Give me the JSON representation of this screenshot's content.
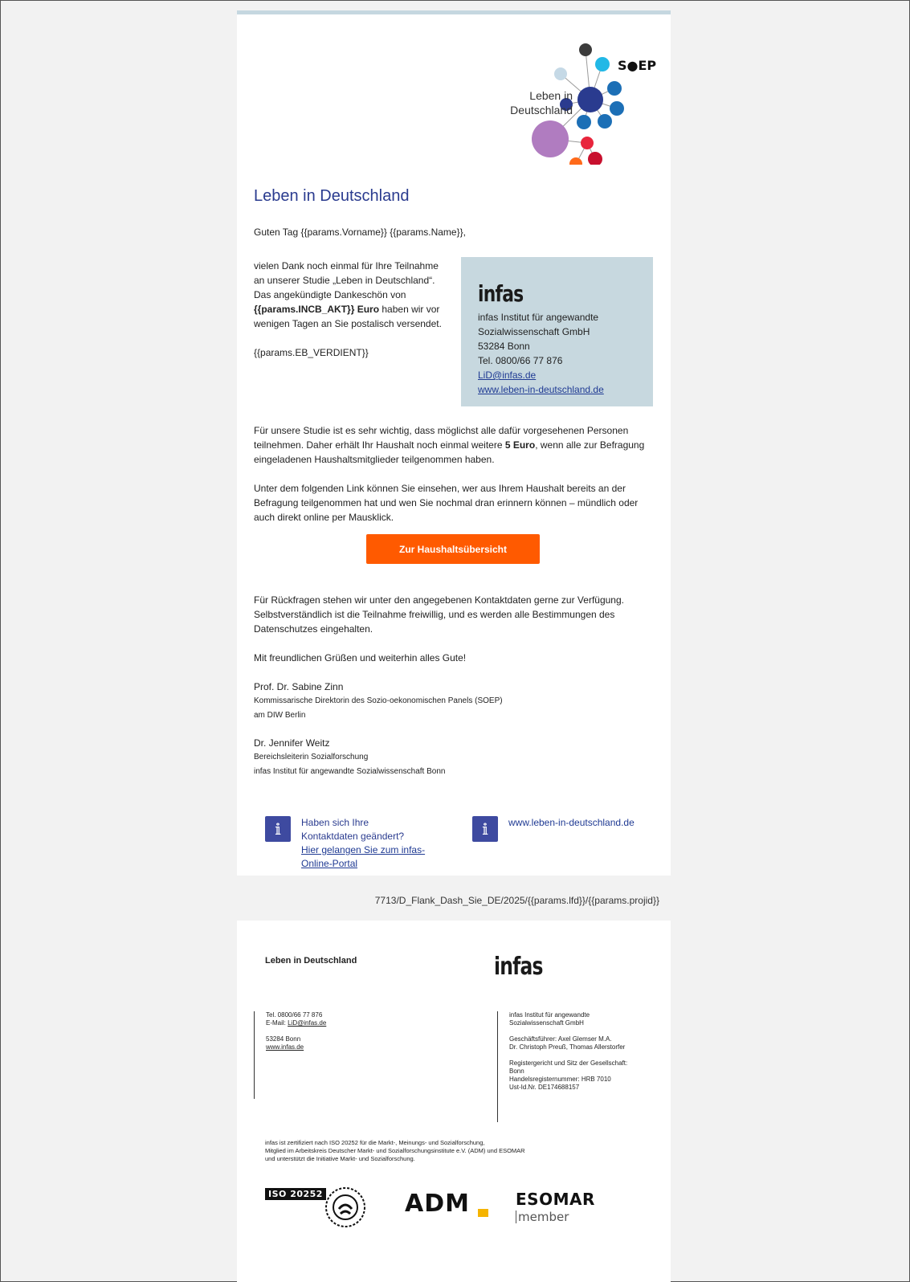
{
  "header": {
    "logo_text_line1": "Leben in",
    "logo_text_line2": "Deutschland",
    "logo_soep": "S●EP"
  },
  "title": "Leben in Deutschland",
  "greeting": "Guten Tag {{params.Vorname}} {{params.Name}},",
  "intro": {
    "part1": "vielen Dank noch einmal für Ihre Teilnahme an unserer Studie „Leben in Deutschland“. Das angekündigte Dankeschön von ",
    "amount_bold": "{{params.INCB_AKT}} Euro",
    "part2": " haben wir vor wenigen Tagen an Sie postalisch versendet.",
    "eb_param": "{{params.EB_VERDIENT}}"
  },
  "infobox": {
    "logo": "infas",
    "line1": "infas Institut für angewandte",
    "line2": "Sozialwissenschaft GmbH",
    "line3": "53284 Bonn",
    "line4": "Tel. 0800/66 77 876",
    "email": "LiD@infas.de",
    "web": "www.leben-in-deutschland.de"
  },
  "para1": {
    "before": "Für unsere Studie ist es sehr wichtig, dass möglichst alle dafür vorgesehenen Personen teilnehmen. Daher erhält Ihr Haushalt noch einmal weitere ",
    "bold": "5 Euro",
    "after": ", wenn alle zur Befragung eingeladenen Haushaltsmitglieder teilgenommen haben."
  },
  "para2": "Unter dem folgenden Link können Sie einsehen, wer aus Ihrem Haushalt bereits an der Befragung teilgenommen hat und wen Sie nochmal dran erinnern können – mündlich oder auch direkt online per Mausklick.",
  "cta_label": "Zur Haushaltsübersicht",
  "para3": "Für Rückfragen stehen wir unter den angegebenen Kontaktdaten gerne zur Verfügung. Selbstverständlich ist die Teilnahme freiwillig, und es werden alle Bestimmungen des Datenschutzes eingehalten.",
  "closing": "Mit freundlichen Grüßen und weiterhin alles Gute!",
  "signer1": {
    "name": "Prof. Dr. Sabine Zinn",
    "role1": "Kommissarische Direktorin des Sozio-oekonomischen Panels (SOEP)",
    "role2": "am DIW Berlin"
  },
  "signer2": {
    "name": "Dr. Jennifer Weitz",
    "role1": "Bereichsleiterin Sozialforschung",
    "role2": "infas Institut für angewandte Sozialwissenschaft Bonn"
  },
  "links": {
    "contact_text1": "Haben sich Ihre",
    "contact_text2": "Kontaktdaten geändert?",
    "contact_link": "Hier gelangen Sie zum infas-Online-Portal",
    "web": "www.leben-in-deutschland.de"
  },
  "meta_id": "7713/D_Flank_Dash_Sie_DE/2025/{{params.lfd}}/{{params.projid}}",
  "footer": {
    "lid_title": "Leben in Deutschland",
    "infas_logo": "infas",
    "left": {
      "tel": "Tel. 0800/66 77 876",
      "email_label": "E-Mail: ",
      "email": "LiD@infas.de",
      "city": "53284 Bonn",
      "web": "www.infas.de"
    },
    "right": {
      "name1": "infas Institut für angewandte",
      "name2": "Sozialwissenschaft GmbH",
      "gf1": "Geschäftsführer: Axel Glemser M.A.",
      "gf2": "Dr. Christoph Preuß, Thomas Allerstorfer",
      "reg1": "Registergericht und Sitz der Gesellschaft:",
      "reg2": "Bonn",
      "reg3": "Handelsregisternummer: HRB 7010",
      "reg4": "Ust-Id.Nr. DE174688157"
    },
    "cert1": "infas ist zertifiziert nach ISO 20252 für die Markt-, Meinungs- und Sozialforschung,",
    "cert2": "Mitglied im Arbeitskreis Deutscher Markt- und Sozialforschungsinstitute e.V. (ADM) und ESOMAR",
    "cert3": "und unterstützt die Initiative Markt- und Sozialforschung.",
    "iso_label": "ISO 20252",
    "adm_label": "ADM",
    "esomar_label": "ESOMAR",
    "member_label": "member"
  },
  "colors": {
    "title_blue": "#2a3b8f",
    "infobox_bg": "#c7d8df",
    "cta_orange": "#ff5a00",
    "icon_blue": "#3e4aa0"
  }
}
